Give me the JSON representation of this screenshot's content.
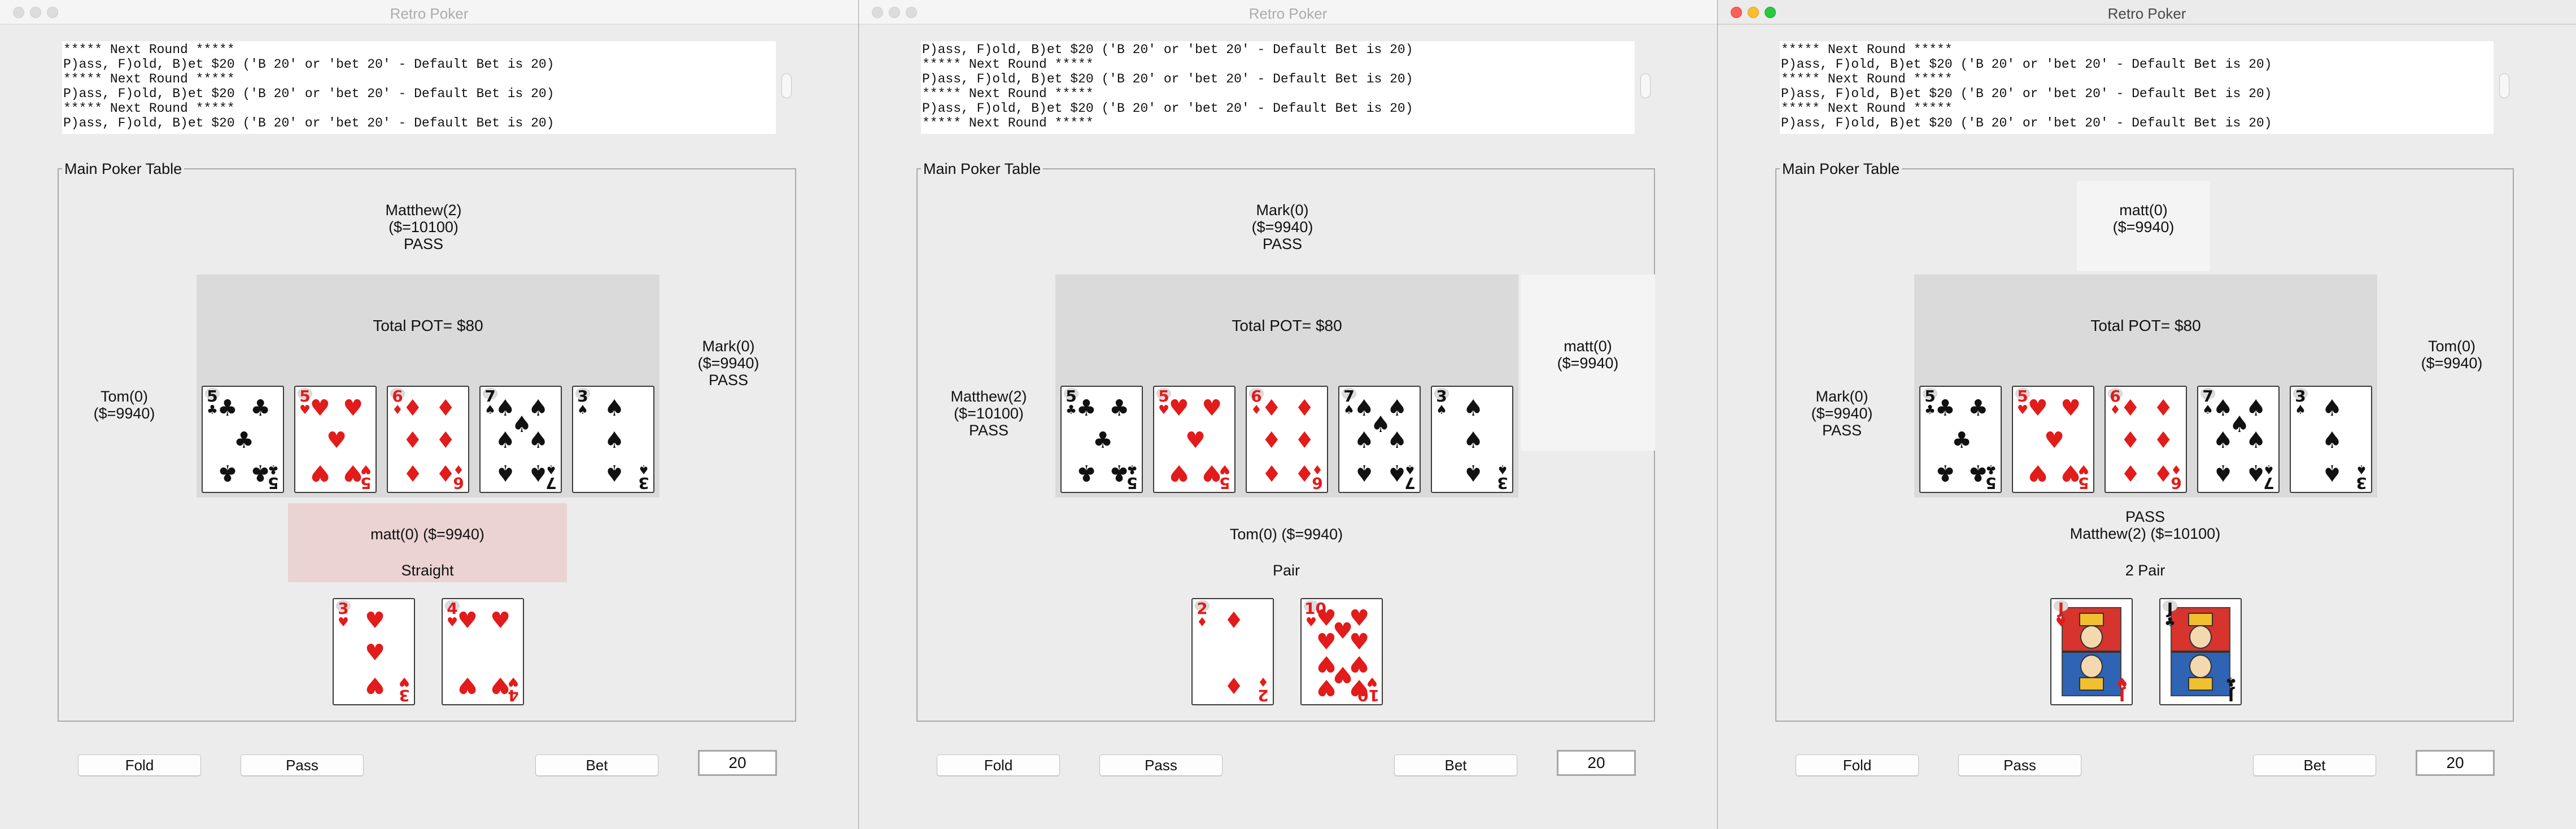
{
  "windows": [
    {
      "title": "Retro Poker",
      "active": false,
      "log": [
        "***** Next Round *****",
        "P)ass, F)old, B)et $20 ('B 20' or 'bet 20' - Default Bet is 20)",
        "***** Next Round *****",
        "P)ass, F)old, B)et $20 ('B 20' or 'bet 20' - Default Bet is 20)",
        "***** Next Round *****",
        "P)ass, F)old, B)et $20 ('B 20' or 'bet 20' - Default Bet is 20)"
      ],
      "table_label": "Main Poker Table",
      "pot": "Total POT= $80",
      "top_player": [
        "Matthew(2)",
        "($=10100)",
        "PASS"
      ],
      "left_player": [
        "Tom(0)",
        "($=9940)"
      ],
      "right_player": [
        "Mark(0)",
        "($=9940)",
        "PASS"
      ],
      "bottom_player": [
        "matt(0) ($=9940)"
      ],
      "hand_result": "Straight",
      "board": [
        {
          "rank": "5",
          "suit": "♣",
          "color": "black"
        },
        {
          "rank": "5",
          "suit": "♥",
          "color": "red"
        },
        {
          "rank": "6",
          "suit": "♦",
          "color": "red"
        },
        {
          "rank": "7",
          "suit": "♠",
          "color": "black"
        },
        {
          "rank": "3",
          "suit": "♠",
          "color": "black"
        }
      ],
      "hand": [
        {
          "rank": "3",
          "suit": "♥",
          "color": "red"
        },
        {
          "rank": "4",
          "suit": "♥",
          "color": "red"
        }
      ],
      "buttons": {
        "fold": "Fold",
        "pass": "Pass",
        "bet": "Bet"
      },
      "bet_amount": "20"
    },
    {
      "title": "Retro Poker",
      "active": false,
      "log": [
        "P)ass, F)old, B)et $20 ('B 20' or 'bet 20' - Default Bet is 20)",
        "***** Next Round *****",
        "P)ass, F)old, B)et $20 ('B 20' or 'bet 20' - Default Bet is 20)",
        "***** Next Round *****",
        "P)ass, F)old, B)et $20 ('B 20' or 'bet 20' - Default Bet is 20)",
        "***** Next Round *****"
      ],
      "table_label": "Main Poker Table",
      "pot": "Total POT= $80",
      "top_player": [
        "Mark(0)",
        "($=9940)",
        "PASS"
      ],
      "left_player": [
        "Matthew(2)",
        "($=10100)",
        "PASS"
      ],
      "right_player": [
        "matt(0)",
        "($=9940)"
      ],
      "bottom_player": [
        "Tom(0) ($=9940)"
      ],
      "hand_result": "Pair",
      "board": [
        {
          "rank": "5",
          "suit": "♣",
          "color": "black"
        },
        {
          "rank": "5",
          "suit": "♥",
          "color": "red"
        },
        {
          "rank": "6",
          "suit": "♦",
          "color": "red"
        },
        {
          "rank": "7",
          "suit": "♠",
          "color": "black"
        },
        {
          "rank": "3",
          "suit": "♠",
          "color": "black"
        }
      ],
      "hand": [
        {
          "rank": "2",
          "suit": "♦",
          "color": "red"
        },
        {
          "rank": "10",
          "suit": "♥",
          "color": "red"
        }
      ],
      "buttons": {
        "fold": "Fold",
        "pass": "Pass",
        "bet": "Bet"
      },
      "bet_amount": "20"
    },
    {
      "title": "Retro Poker",
      "active": true,
      "log": [
        "***** Next Round *****",
        "P)ass, F)old, B)et $20 ('B 20' or 'bet 20' - Default Bet is 20)",
        "***** Next Round *****",
        "P)ass, F)old, B)et $20 ('B 20' or 'bet 20' - Default Bet is 20)",
        "***** Next Round *****",
        "P)ass, F)old, B)et $20 ('B 20' or 'bet 20' - Default Bet is 20)"
      ],
      "table_label": "Main Poker Table",
      "pot": "Total POT= $80",
      "top_player": [
        "matt(0)",
        "($=9940)"
      ],
      "left_player": [
        "Mark(0)",
        "($=9940)",
        "PASS"
      ],
      "right_player": [
        "Tom(0)",
        "($=9940)"
      ],
      "bottom_player": [
        "PASS",
        "Matthew(2) ($=10100)"
      ],
      "hand_result": "2 Pair",
      "board": [
        {
          "rank": "5",
          "suit": "♣",
          "color": "black"
        },
        {
          "rank": "5",
          "suit": "♥",
          "color": "red"
        },
        {
          "rank": "6",
          "suit": "♦",
          "color": "red"
        },
        {
          "rank": "7",
          "suit": "♠",
          "color": "black"
        },
        {
          "rank": "3",
          "suit": "♠",
          "color": "black"
        }
      ],
      "hand": [
        {
          "rank": "J",
          "suit": "♥",
          "color": "red"
        },
        {
          "rank": "J",
          "suit": "♣",
          "color": "black"
        }
      ],
      "buttons": {
        "fold": "Fold",
        "pass": "Pass",
        "bet": "Bet"
      },
      "bet_amount": "20"
    }
  ]
}
